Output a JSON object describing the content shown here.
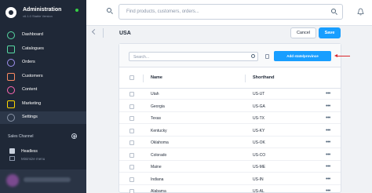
{
  "app": {
    "title": "Administration",
    "version": "v6.1.0 Stable Version"
  },
  "colors": {
    "sidebar_bg": "#1f2837",
    "accent": "#189eff",
    "annotation": "#d9262c",
    "status_online": "#37d046"
  },
  "sidebar": {
    "items": [
      {
        "label": "Dashboard",
        "icon": "dashboard-icon",
        "color": "#57d9a3"
      },
      {
        "label": "Catalogues",
        "icon": "catalogues-icon",
        "color": "#57d9a3"
      },
      {
        "label": "Orders",
        "icon": "orders-icon",
        "color": "#a092f0"
      },
      {
        "label": "Customers",
        "icon": "customers-icon",
        "color": "#f88962"
      },
      {
        "label": "Content",
        "icon": "content-icon",
        "color": "#ff68b4"
      },
      {
        "label": "Marketing",
        "icon": "marketing-icon",
        "color": "#ffd700"
      },
      {
        "label": "Settings",
        "icon": "settings-icon",
        "color": "#8a95a8",
        "active": true
      }
    ],
    "sales_channel_label": "Sales Channel",
    "headless_label": "Headless",
    "minimize_label": "Minimize menu"
  },
  "topbar": {
    "search_placeholder": "Find products, customers, orders..."
  },
  "smartbar": {
    "title": "USA",
    "cancel_label": "Cancel",
    "save_label": "Save"
  },
  "list": {
    "search_placeholder": "Search...",
    "add_button_label": "Add state/province",
    "columns": {
      "name": "Name",
      "shorthand": "Shorthand"
    },
    "rows": [
      {
        "name": "Utah",
        "shorthand": "US-UT"
      },
      {
        "name": "Georgia",
        "shorthand": "US-GA"
      },
      {
        "name": "Texas",
        "shorthand": "US-TX"
      },
      {
        "name": "Kentucky",
        "shorthand": "US-KY"
      },
      {
        "name": "Oklahoma",
        "shorthand": "US-OK"
      },
      {
        "name": "Colorado",
        "shorthand": "US-CO"
      },
      {
        "name": "Maine",
        "shorthand": "US-ME"
      },
      {
        "name": "Indiana",
        "shorthand": "US-IN"
      },
      {
        "name": "Alabama",
        "shorthand": "US-AL"
      }
    ],
    "row_menu_glyph": "•••"
  }
}
